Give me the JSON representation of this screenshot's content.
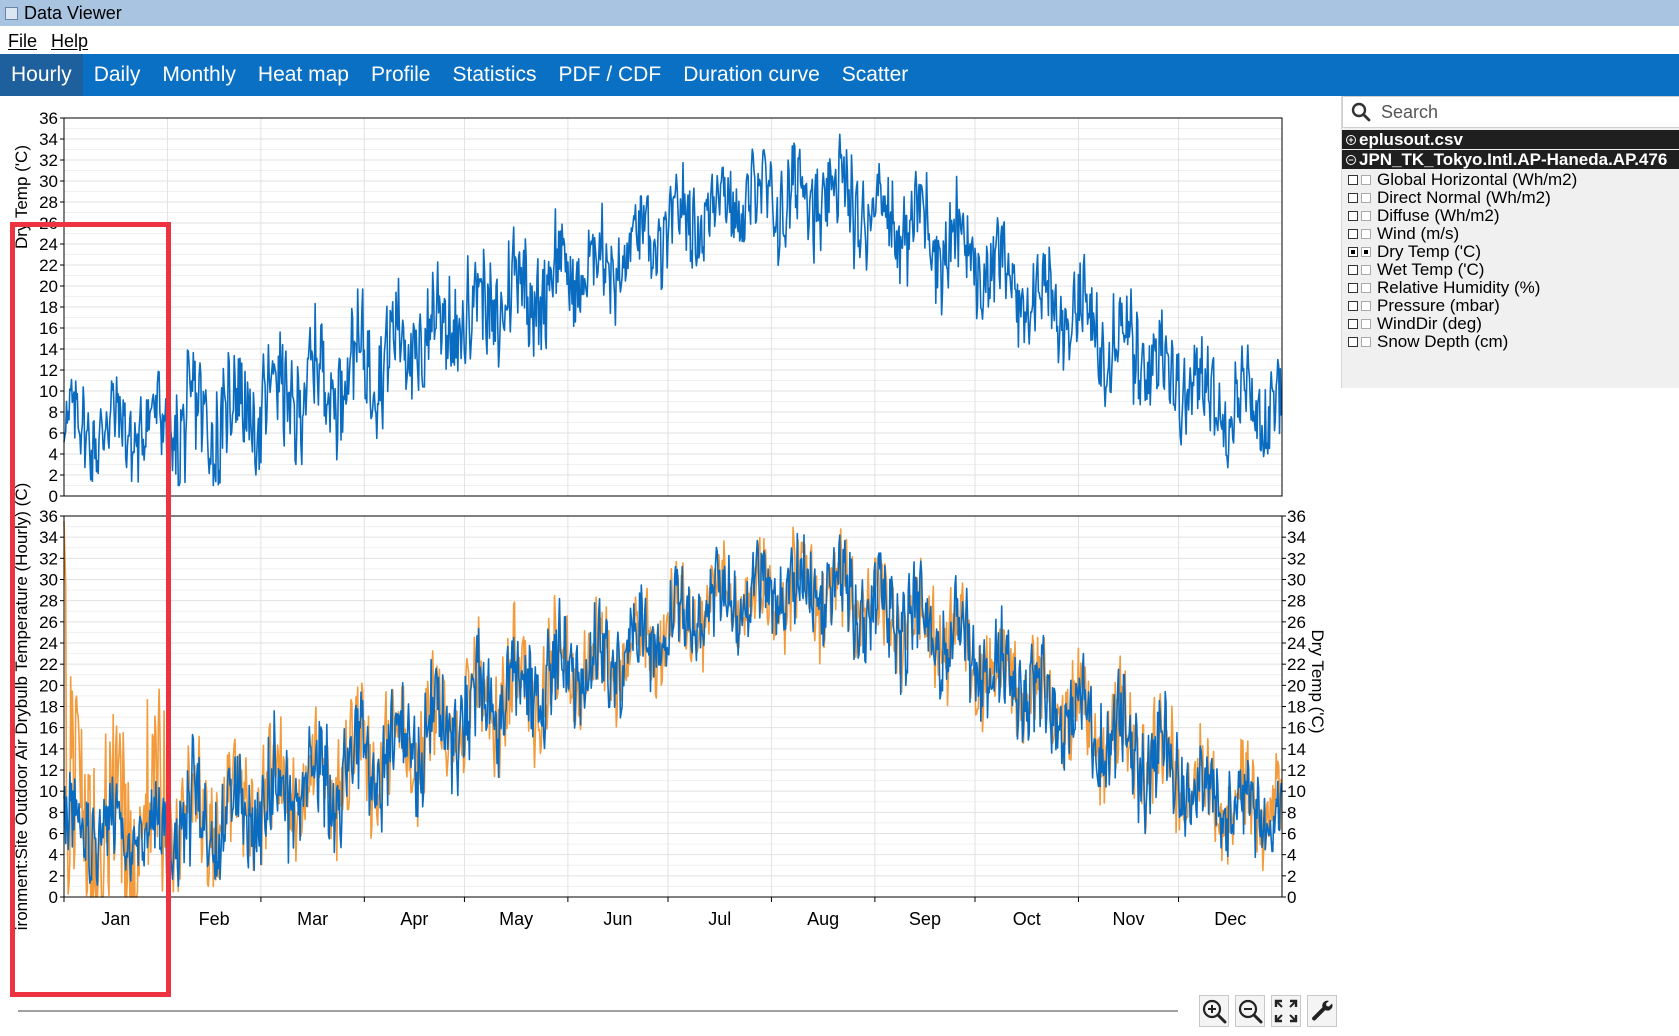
{
  "window": {
    "title": "Data Viewer"
  },
  "menu": {
    "file": "File",
    "help": "Help"
  },
  "tabs": [
    {
      "label": "Hourly",
      "active": true
    },
    {
      "label": "Daily"
    },
    {
      "label": "Monthly"
    },
    {
      "label": "Heat map"
    },
    {
      "label": "Profile"
    },
    {
      "label": "Statistics"
    },
    {
      "label": "PDF / CDF"
    },
    {
      "label": "Duration curve"
    },
    {
      "label": "Scatter"
    }
  ],
  "search": {
    "placeholder": "Search"
  },
  "tree": {
    "files": [
      {
        "name": "eplusout.csv",
        "expanded": false
      },
      {
        "name": "JPN_TK_Tokyo.Intl.AP-Haneda.AP.476",
        "expanded": true
      }
    ],
    "variables": [
      {
        "label": "Global Horizontal (Wh/m2)",
        "checked": false
      },
      {
        "label": "Direct Normal (Wh/m2)",
        "checked": false
      },
      {
        "label": "Diffuse (Wh/m2)",
        "checked": false
      },
      {
        "label": "Wind (m/s)",
        "checked": false
      },
      {
        "label": "Dry Temp ('C)",
        "checked": true
      },
      {
        "label": "Wet Temp ('C)",
        "checked": false
      },
      {
        "label": "Relative Humidity (%)",
        "checked": false
      },
      {
        "label": "Pressure (mbar)",
        "checked": false
      },
      {
        "label": "WindDir (deg)",
        "checked": false
      },
      {
        "label": "Snow Depth (cm)",
        "checked": false
      }
    ]
  },
  "toolbar": {
    "icons": [
      "zoom-in-icon",
      "zoom-out-icon",
      "fit-view-icon",
      "wrench-icon"
    ]
  },
  "colors": {
    "series_blue": "#0a6cc0",
    "series_orange": "#f39a3b",
    "tab_bar": "#0970c4",
    "highlight": "#ee3340"
  },
  "chart_data": [
    {
      "type": "line",
      "ylabel": "Dry Temp ('C)",
      "ylim": [
        0,
        36
      ],
      "yticks": [
        0,
        2,
        4,
        6,
        8,
        10,
        12,
        14,
        16,
        18,
        20,
        22,
        24,
        26,
        28,
        30,
        32,
        34,
        36
      ],
      "months": [
        "Jan",
        "Feb",
        "Mar",
        "Apr",
        "May",
        "Jun",
        "Jul",
        "Aug",
        "Sep",
        "Oct",
        "Nov",
        "Dec"
      ],
      "grid": true,
      "series": [
        {
          "color": "#0a6cc0",
          "monthly_mean": [
            6.5,
            7.2,
            10.5,
            14.8,
            19.5,
            22.5,
            28.0,
            28.8,
            25.5,
            19.5,
            14.2,
            8.5
          ],
          "monthly_min": [
            0.2,
            1.0,
            3.0,
            5.5,
            11.0,
            15.0,
            20.5,
            18.5,
            15.5,
            12.0,
            5.0,
            1.0
          ],
          "monthly_max": [
            14.5,
            20.5,
            22.0,
            24.0,
            30.0,
            30.5,
            35.0,
            35.5,
            32.5,
            27.5,
            23.0,
            16.0
          ]
        }
      ]
    },
    {
      "type": "line",
      "ylabel": "ironment:Site Outdoor Air Drybulb Temperature (Hourly) (C)",
      "y2label": "Dry Temp ('C)",
      "ylim": [
        0,
        36
      ],
      "yticks": [
        0,
        2,
        4,
        6,
        8,
        10,
        12,
        14,
        16,
        18,
        20,
        22,
        24,
        26,
        28,
        30,
        32,
        34,
        36
      ],
      "categories": [
        "Jan",
        "Feb",
        "Mar",
        "Apr",
        "May",
        "Jun",
        "Jul",
        "Aug",
        "Sep",
        "Oct",
        "Nov",
        "Dec"
      ],
      "grid": true,
      "series": [
        {
          "color": "#f39a3b",
          "axis": "left",
          "monthly_mean": [
            6.8,
            7.5,
            10.8,
            15.0,
            19.8,
            22.8,
            28.2,
            28.9,
            25.6,
            19.8,
            14.5,
            8.8
          ],
          "monthly_min": [
            0.0,
            0.5,
            2.5,
            5.0,
            10.5,
            14.5,
            20.0,
            18.0,
            15.0,
            11.5,
            4.5,
            0.5
          ],
          "monthly_max": [
            35.5,
            20.0,
            22.5,
            24.5,
            30.5,
            31.0,
            35.0,
            35.5,
            32.0,
            28.0,
            23.5,
            16.5
          ]
        },
        {
          "color": "#0a6cc0",
          "axis": "right",
          "monthly_mean": [
            6.5,
            7.2,
            10.5,
            14.8,
            19.5,
            22.5,
            28.0,
            28.8,
            25.5,
            19.5,
            14.2,
            8.5
          ],
          "monthly_min": [
            0.2,
            1.0,
            3.0,
            5.5,
            11.0,
            15.0,
            20.5,
            18.5,
            15.5,
            12.0,
            5.0,
            1.0
          ],
          "monthly_max": [
            14.5,
            20.5,
            22.0,
            24.0,
            30.0,
            30.5,
            35.0,
            35.5,
            32.5,
            27.5,
            23.0,
            16.0
          ]
        }
      ]
    }
  ]
}
